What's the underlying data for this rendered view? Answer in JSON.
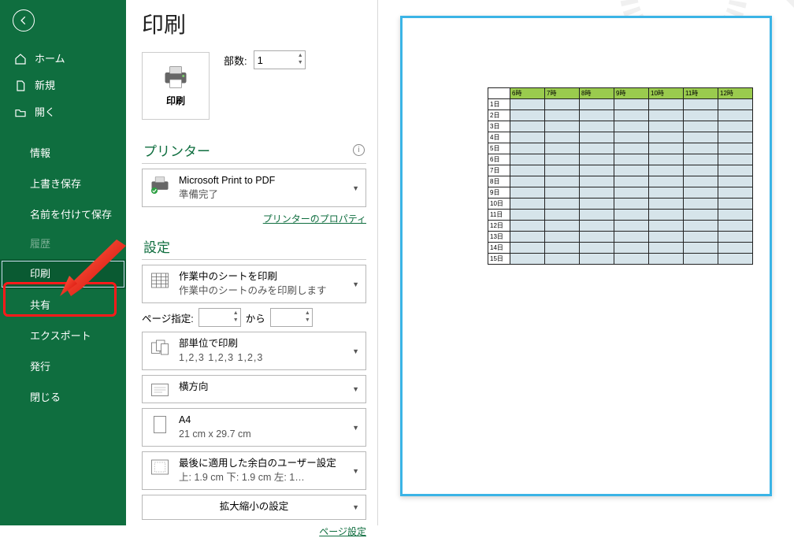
{
  "sidebar": {
    "items": [
      {
        "label": "ホーム"
      },
      {
        "label": "新規"
      },
      {
        "label": "開く"
      }
    ],
    "more": [
      {
        "label": "情報"
      },
      {
        "label": "上書き保存"
      },
      {
        "label": "名前を付けて保存"
      },
      {
        "label": "履歴",
        "disabled": true
      },
      {
        "label": "印刷",
        "selected": true
      },
      {
        "label": "共有"
      },
      {
        "label": "エクスポート"
      },
      {
        "label": "発行"
      },
      {
        "label": "閉じる"
      }
    ]
  },
  "title": "印刷",
  "print_button_label": "印刷",
  "copies": {
    "label": "部数:",
    "value": "1"
  },
  "printer": {
    "header": "プリンター",
    "name": "Microsoft Print to PDF",
    "status": "準備完了",
    "properties_link": "プリンターのプロパティ"
  },
  "settings": {
    "header": "設定",
    "what": {
      "title": "作業中のシートを印刷",
      "sub": "作業中のシートのみを印刷します"
    },
    "pages": {
      "label": "ページ指定:",
      "to": "から"
    },
    "collate": {
      "title": "部単位で印刷",
      "sub": "1,2,3   1,2,3   1,2,3"
    },
    "orientation": {
      "title": "横方向"
    },
    "paper": {
      "title": "A4",
      "sub": "21 cm x 29.7 cm"
    },
    "margins": {
      "title": "最後に適用した余白のユーザー設定",
      "sub": "上: 1.9 cm 下: 1.9 cm 左: 1…"
    },
    "scaling": {
      "title": "拡大縮小の設定"
    },
    "page_setup_link": "ページ設定"
  },
  "preview": {
    "hours": [
      "6時",
      "7時",
      "8時",
      "9時",
      "10時",
      "11時",
      "12時"
    ],
    "rows": [
      "1日",
      "2日",
      "3日",
      "4日",
      "5日",
      "6日",
      "7日",
      "8日",
      "9日",
      "10日",
      "11日",
      "12日",
      "13日",
      "14日",
      "15日"
    ]
  }
}
